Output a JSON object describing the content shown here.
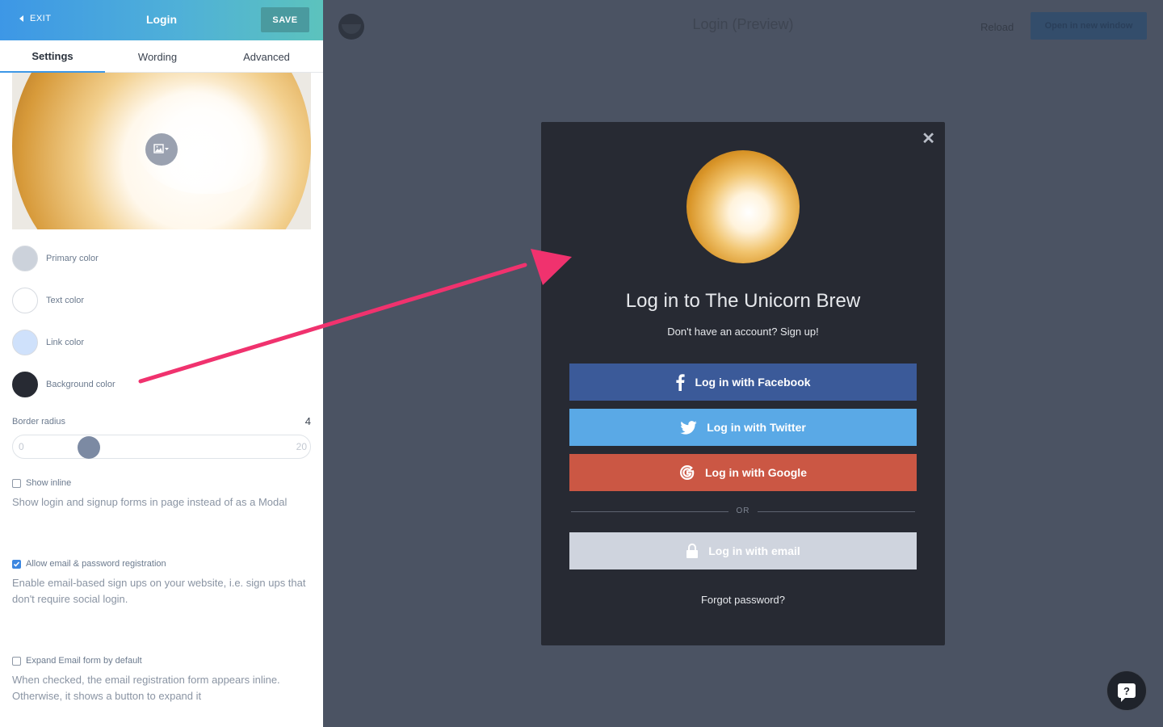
{
  "header": {
    "exit_label": "EXIT",
    "title": "Login",
    "save_label": "SAVE"
  },
  "tabs": [
    {
      "label": "Settings",
      "active": true
    },
    {
      "label": "Wording",
      "active": false
    },
    {
      "label": "Advanced",
      "active": false
    }
  ],
  "colors": [
    {
      "label": "Primary color",
      "value": "#ccd2db"
    },
    {
      "label": "Text color",
      "value": "#ffffff"
    },
    {
      "label": "Link color",
      "value": "#cfe1fb"
    },
    {
      "label": "Background color",
      "value": "#272a33"
    }
  ],
  "border_radius": {
    "label": "Border radius",
    "value": "4",
    "min": "0",
    "max": "20"
  },
  "options": [
    {
      "label": "Show inline",
      "checked": false,
      "help": "Show login and signup forms in page instead of as a Modal"
    },
    {
      "label": "Allow email & password registration",
      "checked": true,
      "help": "Enable email-based sign ups on your website, i.e. sign ups that don't require social login."
    },
    {
      "label": "Expand Email form by default",
      "checked": false,
      "help": "When checked, the email registration form appears inline. Otherwise, it shows a button to expand it"
    }
  ],
  "preview": {
    "title": "Login (Preview)",
    "reload_label": "Reload",
    "open_label": "Open in new window"
  },
  "modal": {
    "close_icon": "close-icon",
    "title": "Log in to The Unicorn Brew",
    "subtitle": "Don't have an account? Sign up!",
    "facebook_label": "Log in with Facebook",
    "twitter_label": "Log in with Twitter",
    "google_label": "Log in with Google",
    "or_label": "OR",
    "email_label": "Log in with email",
    "forgot_label": "Forgot password?",
    "brand_colors": {
      "facebook": "#3b5a99",
      "twitter": "#5aa9e6",
      "google": "#cb5744",
      "email": "#cfd4de"
    }
  },
  "annotation_arrow_color": "#f0326e"
}
